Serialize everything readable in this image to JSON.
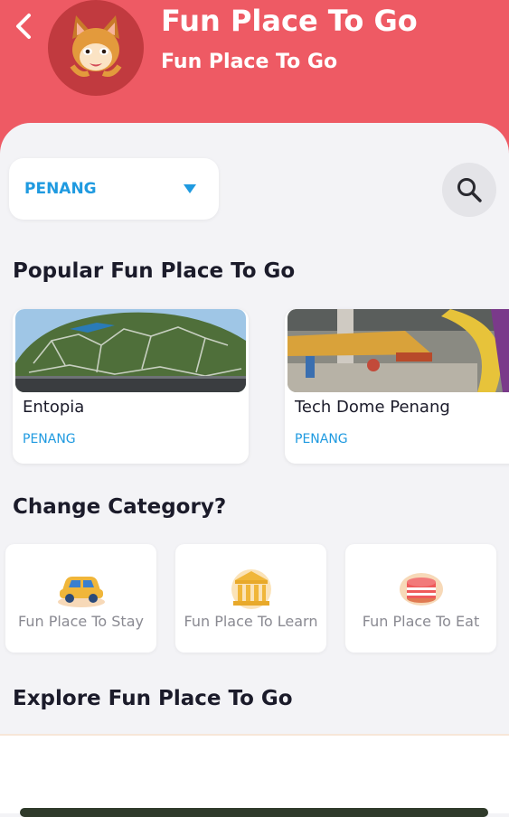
{
  "header": {
    "title": "Fun Place To Go",
    "subtitle": "Fun Place To Go",
    "bg_color": "#ee5a64"
  },
  "location_select": {
    "value": "PENANG"
  },
  "popular": {
    "heading": "Popular Fun Place To Go",
    "items": [
      {
        "name": "Entopia",
        "location": "PENANG"
      },
      {
        "name": "Tech Dome Penang",
        "location": "PENANG"
      }
    ]
  },
  "categories": {
    "heading": "Change Category?",
    "items": [
      {
        "label": "Fun Place To Stay",
        "icon": "car-icon"
      },
      {
        "label": "Fun Place To Learn",
        "icon": "museum-icon"
      },
      {
        "label": "Fun Place To Eat",
        "icon": "cake-icon"
      }
    ]
  },
  "explore": {
    "heading": "Explore Fun Place To Go"
  },
  "accent_color": "#1f9ae0"
}
